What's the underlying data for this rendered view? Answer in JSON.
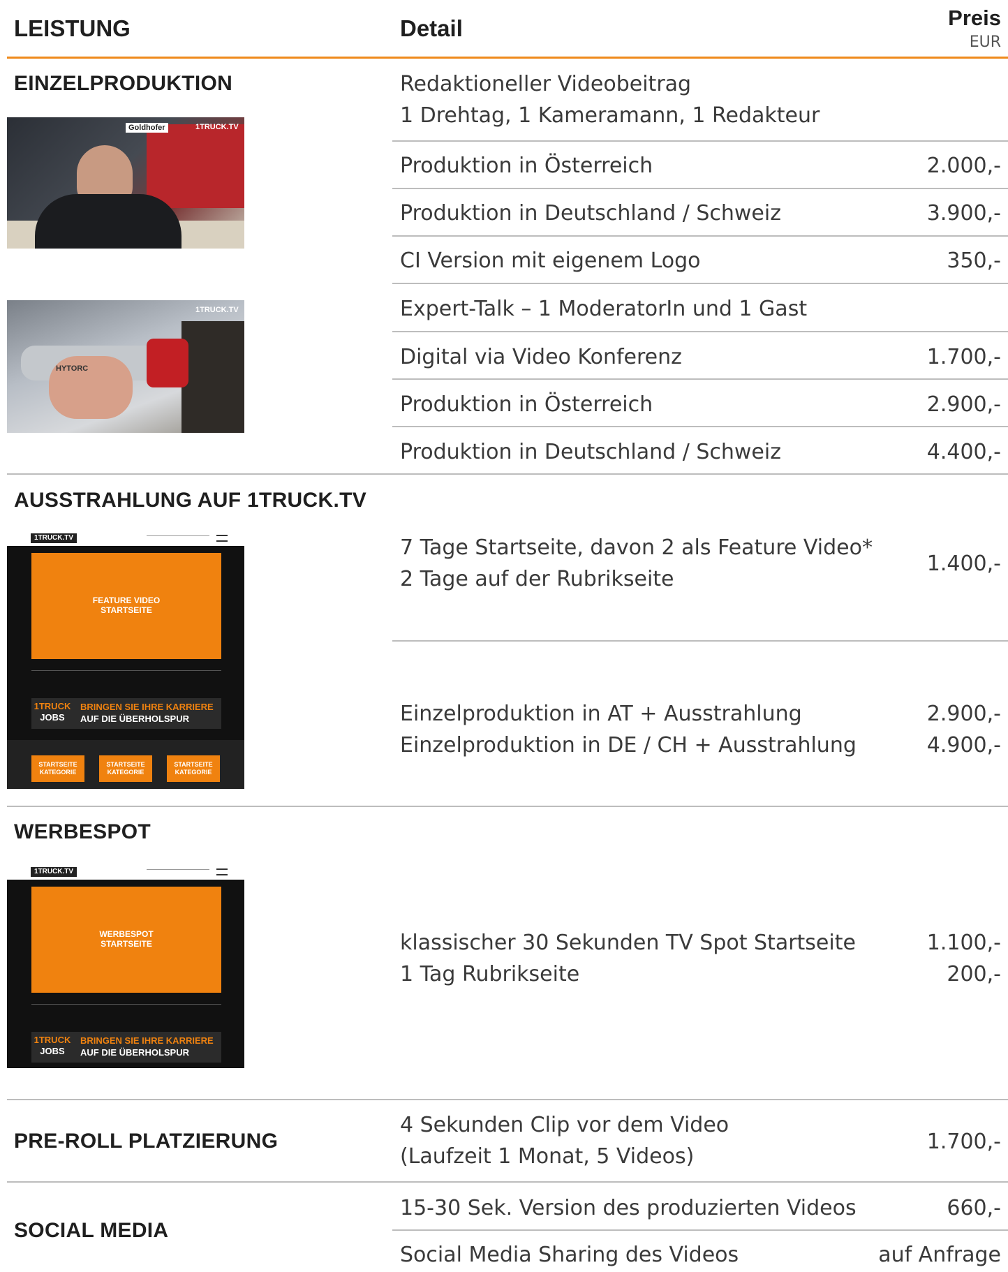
{
  "header": {
    "col_service": "LEISTUNG",
    "col_detail": "Detail",
    "col_price": "Preis",
    "col_currency": "EUR"
  },
  "colors": {
    "accent": "#ef8a1c",
    "divider": "#bdbdbd"
  },
  "sections": {
    "einzel": {
      "title": "EINZELPRODUKTION",
      "intro_1": "Redaktioneller Videobeitrag",
      "intro_2": "1 Drehtag, 1 Kameramann, 1 Redakteur",
      "rows": [
        {
          "detail": "Produktion in Österreich",
          "price": "2.000,-"
        },
        {
          "detail": "Produktion in Deutschland / Schweiz",
          "price": "3.900,-"
        },
        {
          "detail": "CI Version mit eigenem Logo",
          "price": "350,-"
        },
        {
          "detail": "Expert-Talk – 1 ModeratorIn und 1 Gast",
          "price": ""
        },
        {
          "detail": "Digital via Video Konferenz",
          "price": "1.700,-"
        },
        {
          "detail": "Produktion in Österreich",
          "price": "2.900,-"
        },
        {
          "detail": "Produktion in Deutschland / Schweiz",
          "price": "4.400,-"
        }
      ],
      "photo1_labels": [
        "Goldhofer",
        "1TRUCK.TV"
      ],
      "photo2_labels": [
        "1TRUCK.TV",
        "HYTORC"
      ]
    },
    "ausstrahlung": {
      "title": "AUSSTRAHLUNG AUF 1TRUCK.TV",
      "line_1": "7 Tage Startseite, davon 2 als Feature Video*",
      "line_2": "2 Tage auf der Rubrikseite",
      "price": "1.400,-",
      "combo_1": "Einzelproduktion in AT + Ausstrahlung",
      "combo_1_price": "2.900,-",
      "combo_2": "Einzelproduktion in DE / CH + Ausstrahlung",
      "combo_2_price": "4.900,-",
      "mock": {
        "logo": "1TRUCK.TV",
        "feature_1": "FEATURE VIDEO",
        "feature_2": "STARTSEITE",
        "jobs_1": "1TRUCK",
        "jobs_2": "JOBS",
        "banner_1": "BRINGEN SIE IHRE KARRIERE",
        "banner_2": "AUF DIE ÜBERHOLSPUR",
        "cat_1": "STARTSEITE",
        "cat_2": "KATEGORIE"
      }
    },
    "werbespot": {
      "title": "WERBESPOT",
      "line_1": "klassischer 30 Sekunden TV Spot Startseite",
      "price_1": "1.100,-",
      "line_2": "1 Tag Rubrikseite",
      "price_2": "200,-",
      "mock": {
        "logo": "1TRUCK.TV",
        "feature_1": "WERBESPOT",
        "feature_2": "STARTSEITE",
        "jobs_1": "1TRUCK",
        "jobs_2": "JOBS",
        "banner_1": "BRINGEN SIE IHRE KARRIERE",
        "banner_2": "AUF DIE ÜBERHOLSPUR"
      }
    },
    "preroll": {
      "title": "PRE-ROLL PLATZIERUNG",
      "line_1": "4 Sekunden Clip vor dem Video",
      "line_2": "(Laufzeit 1 Monat, 5 Videos)",
      "price": "1.700,-"
    },
    "social": {
      "title": "SOCIAL MEDIA",
      "rows": [
        {
          "detail": "15-30 Sek. Version des produzierten Videos",
          "price": "660,-"
        },
        {
          "detail": "Social Media Sharing des Videos",
          "price": "auf Anfrage"
        }
      ]
    }
  }
}
